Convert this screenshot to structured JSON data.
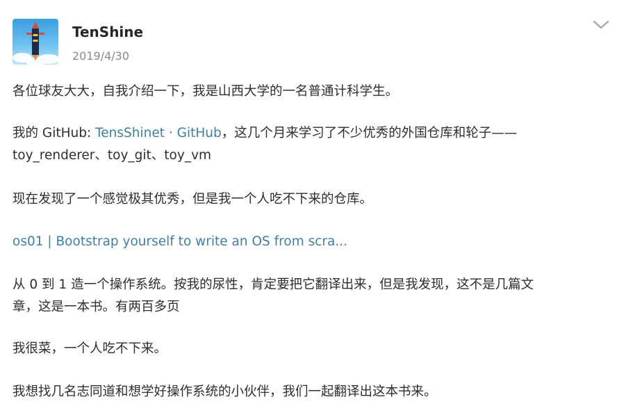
{
  "author": {
    "name": "TenShine",
    "date": "2019/4/30",
    "avatar_icon": "rocket-avatar-icon"
  },
  "menu_icon": "chevron-down-icon",
  "colors": {
    "link": "#3f7fa6",
    "text": "#2e2e2e",
    "meta": "#8a8a8a"
  },
  "body": {
    "p1": "各位球友大大，自我介绍一下，我是山西大学的一名普通计科学生。",
    "p2_prefix": "我的 GitHub: ",
    "p2_link": "TensShinet · GitHub",
    "p2_suffix": "，这几个月来学习了不少优秀的外国仓库和轮子——",
    "p2_line2": "toy_renderer、toy_git、toy_vm",
    "p3": "现在发现了一个感觉极其优秀，但是我一个人吃不下来的仓库。",
    "p4_link": "os01 | Bootstrap yourself to write an OS from scra...",
    "p5_line1": "从 0 到 1 造一个操作系统。按我的尿性，肯定要把它翻译出来，但是我发现，这不是几篇文",
    "p5_line2": "章，这是一本书。有两百多页",
    "p6": "我很菜，一个人吃不下来。",
    "p7": "我想找几名志同道和想学好操作系统的小伙伴，我们一起翻译出这本书来。"
  }
}
